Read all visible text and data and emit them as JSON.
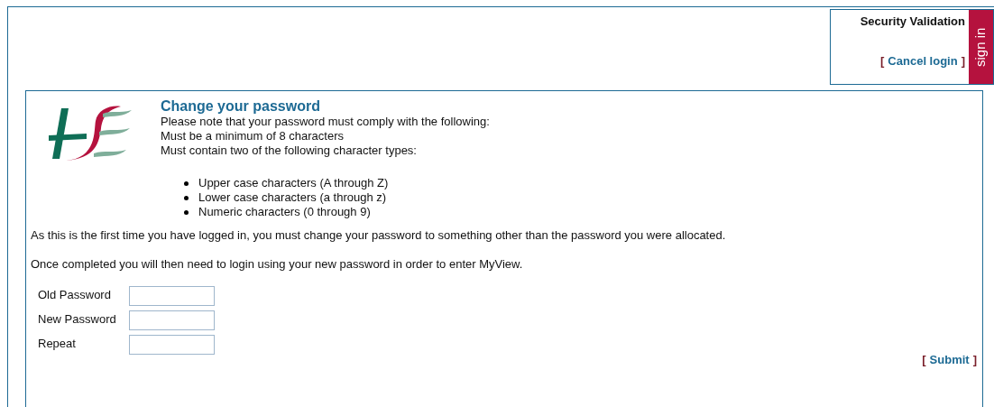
{
  "security_panel": {
    "title": "Security Validation",
    "cancel_link": {
      "open": "[",
      "label": "Cancel login",
      "close": "]"
    },
    "side_tab": "sign in"
  },
  "main": {
    "title": "Change your password",
    "intro": [
      "Please note that your password must comply with the following:",
      "Must be a minimum of 8 characters",
      "Must contain two of the following character types:"
    ],
    "bullets": [
      "Upper case characters (A through Z)",
      "Lower case characters (a through z)",
      "Numeric characters (0 through 9)"
    ],
    "paragraphs": [
      "As this is the first time you have logged in, you must change your password to something other than the password you were allocated.",
      "Once completed you will then need to login using your new password in order to enter MyView."
    ],
    "fields": [
      {
        "label": "Old Password"
      },
      {
        "label": "New Password"
      },
      {
        "label": "Repeat"
      }
    ],
    "submit": {
      "open": "[",
      "label": "Submit",
      "close": "]"
    }
  }
}
